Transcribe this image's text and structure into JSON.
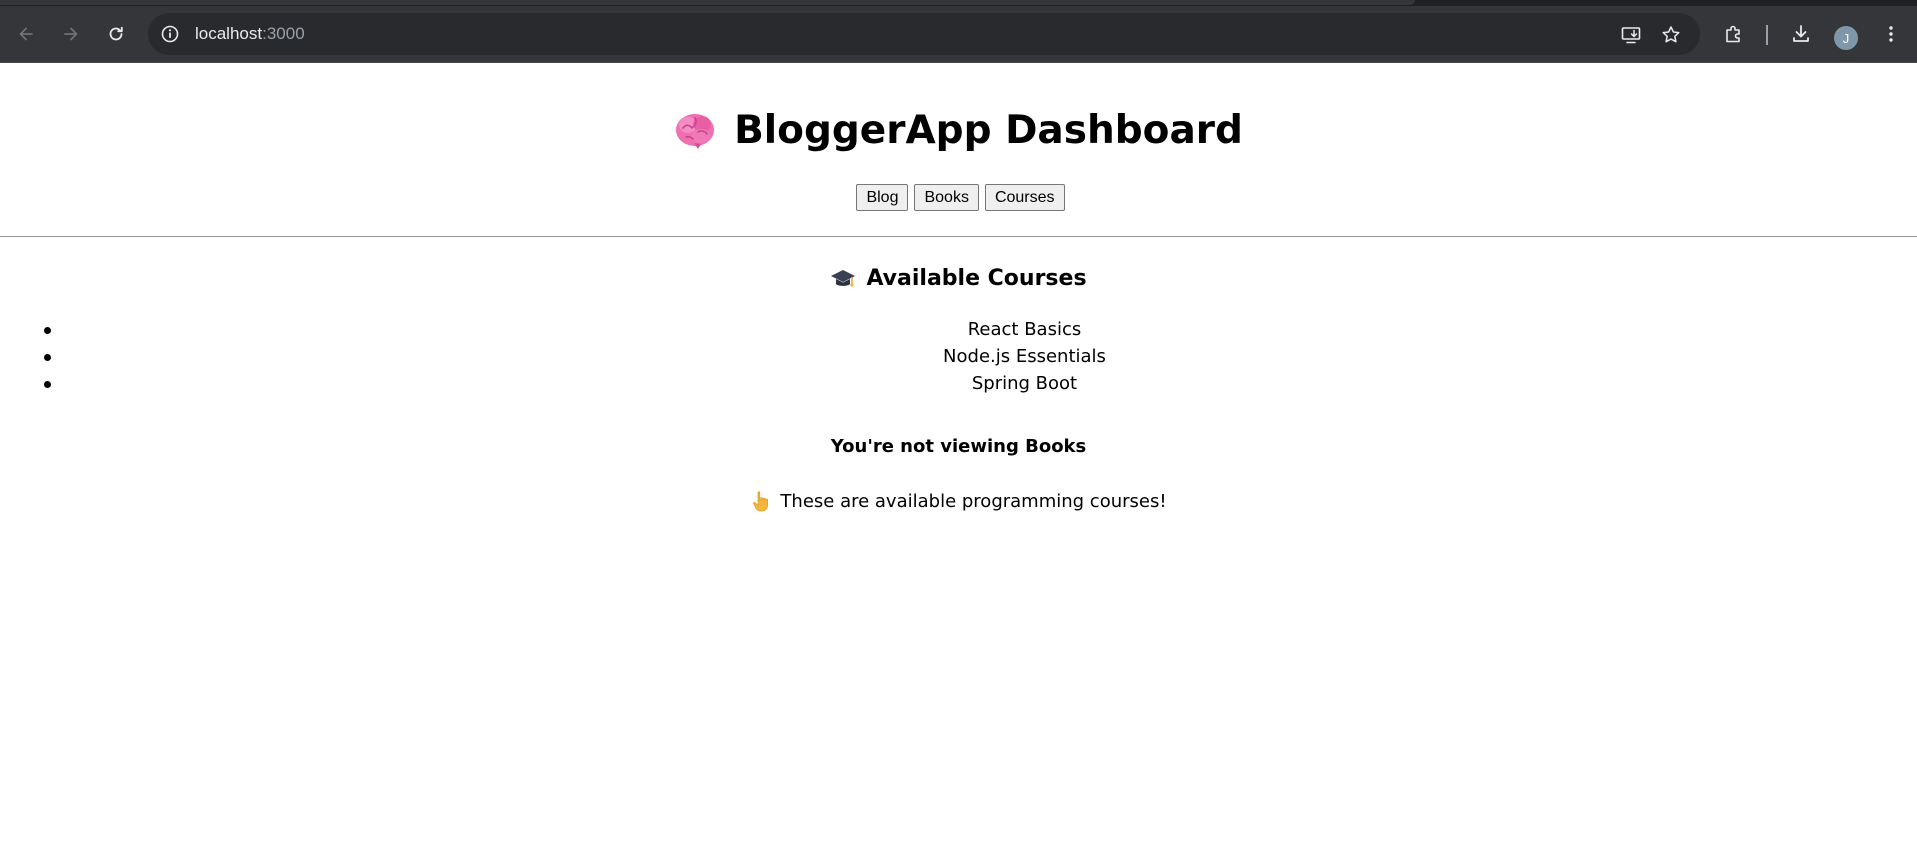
{
  "browser": {
    "url_host": "localhost",
    "url_port": ":3000",
    "profile_initial": "J"
  },
  "header": {
    "title": "BloggerApp Dashboard",
    "title_icon": "brain-icon"
  },
  "nav": {
    "blog_label": "Blog",
    "books_label": "Books",
    "courses_label": "Courses"
  },
  "courses": {
    "heading": "Available Courses",
    "heading_icon": "graduation-cap-icon",
    "items": [
      {
        "label": "React Basics"
      },
      {
        "label": "Node.js Essentials"
      },
      {
        "label": "Spring Boot"
      }
    ]
  },
  "notice": {
    "text": "You're not viewing Books"
  },
  "note": {
    "icon": "pointing-up-hand-icon",
    "text": "These are available programming courses!"
  },
  "colors": {
    "chrome_bg": "#35363a",
    "omnibox_bg": "#282a2e",
    "page_bg": "#ffffff",
    "avatar_bg": "#7f97a8"
  }
}
